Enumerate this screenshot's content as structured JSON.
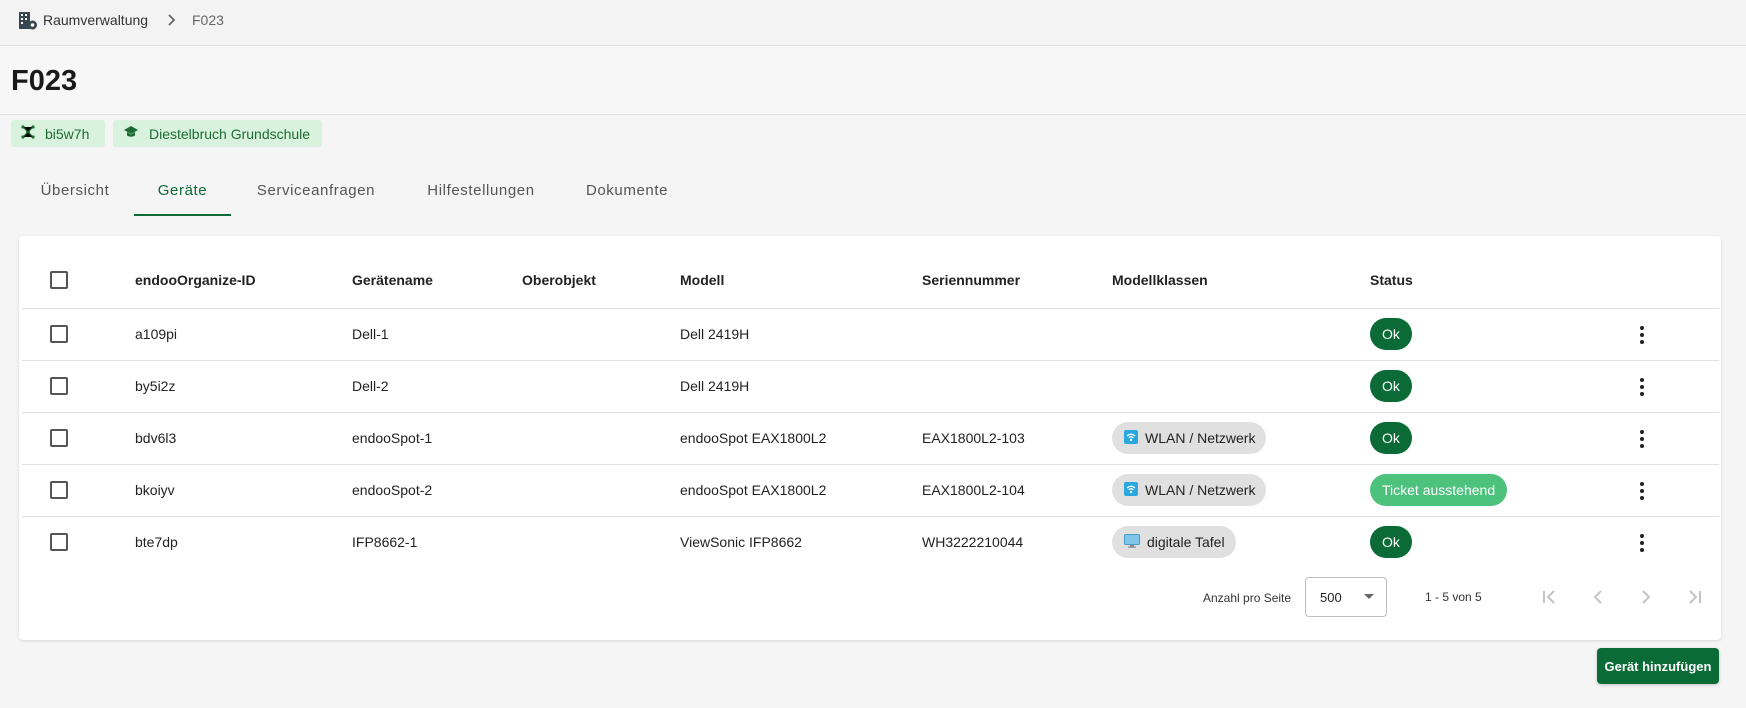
{
  "breadcrumb": {
    "home": "Raumverwaltung",
    "current": "F023"
  },
  "page": {
    "title": "F023"
  },
  "chips": [
    {
      "label": "bi5w7h",
      "icon": "network-icon"
    },
    {
      "label": "Diestelbruch Grundschule",
      "icon": "school-icon"
    }
  ],
  "tabs": [
    {
      "label": "Übersicht",
      "active": false
    },
    {
      "label": "Geräte",
      "active": true
    },
    {
      "label": "Serviceanfragen",
      "active": false
    },
    {
      "label": "Hilfestellungen",
      "active": false
    },
    {
      "label": "Dokumente",
      "active": false
    }
  ],
  "table": {
    "columns": {
      "id": "endooOrganize-ID",
      "name": "Gerätename",
      "parent": "Oberobjekt",
      "model": "Modell",
      "serial": "Seriennummer",
      "classes": "Modellklassen",
      "status": "Status"
    },
    "rows": [
      {
        "id": "a109pi",
        "name": "Dell-1",
        "parent": "",
        "model": "Dell 2419H",
        "serial": "",
        "class": "",
        "class_icon": "",
        "status": "Ok",
        "status_type": "ok"
      },
      {
        "id": "by5i2z",
        "name": "Dell-2",
        "parent": "",
        "model": "Dell 2419H",
        "serial": "",
        "class": "",
        "class_icon": "",
        "status": "Ok",
        "status_type": "ok"
      },
      {
        "id": "bdv6l3",
        "name": "endooSpot-1",
        "parent": "",
        "model": "endooSpot EAX1800L2",
        "serial": "EAX1800L2-103",
        "class": "WLAN / Netzwerk",
        "class_icon": "wifi-icon",
        "status": "Ok",
        "status_type": "ok"
      },
      {
        "id": "bkoiyv",
        "name": "endooSpot-2",
        "parent": "",
        "model": "endooSpot EAX1800L2",
        "serial": "EAX1800L2-104",
        "class": "WLAN / Netzwerk",
        "class_icon": "wifi-icon",
        "status": "Ticket ausstehend",
        "status_type": "pending"
      },
      {
        "id": "bte7dp",
        "name": "IFP8662-1",
        "parent": "",
        "model": "ViewSonic IFP8662",
        "serial": "WH3222210044",
        "class": "digitale Tafel",
        "class_icon": "monitor-icon",
        "status": "Ok",
        "status_type": "ok"
      }
    ]
  },
  "pagination": {
    "per_page_label": "Anzahl pro Seite",
    "per_page_value": "500",
    "range": "1 - 5 von 5"
  },
  "actions": {
    "add_device": "Gerät hinzufügen"
  },
  "colors": {
    "primary": "#0b6b36",
    "status_ok": "#0b6b36",
    "status_pending": "#4cc27d",
    "chip_bg": "#d8f2de",
    "tag_bg": "#e0e0e0"
  }
}
